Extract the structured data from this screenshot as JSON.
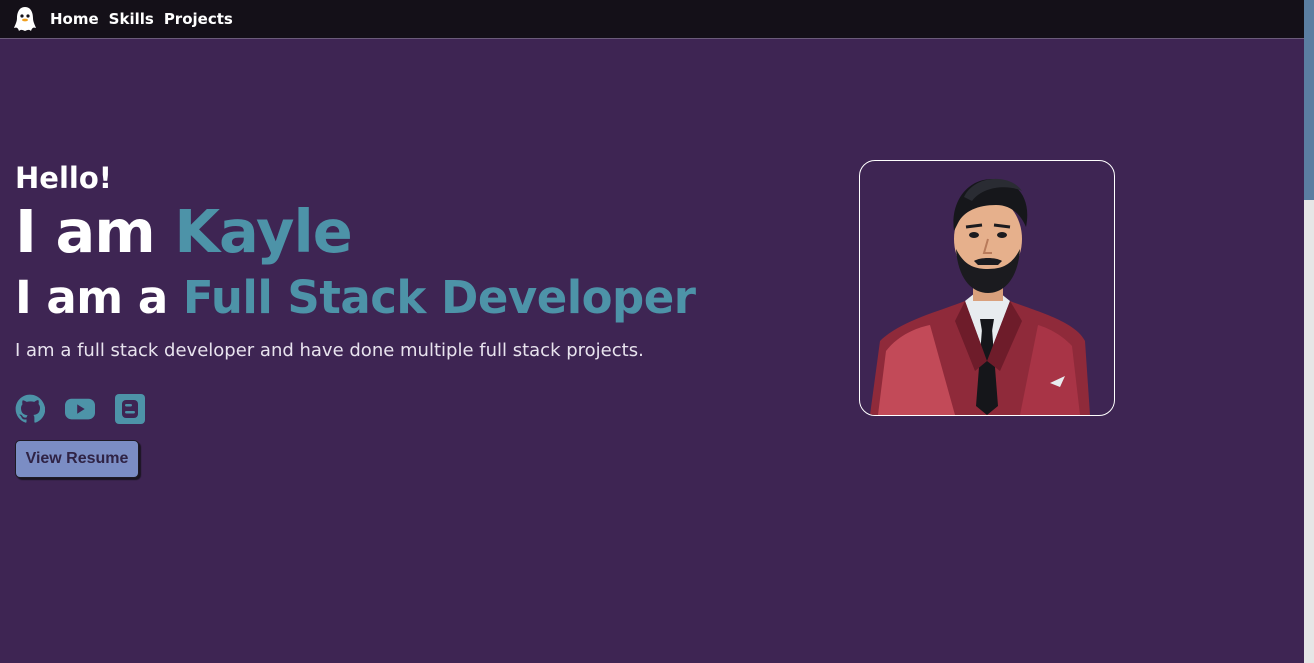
{
  "nav": {
    "logo_icon": "ghost-icon",
    "links": [
      "Home",
      "Skills",
      "Projects"
    ]
  },
  "hero": {
    "greeting": "Hello!",
    "name_prefix": "I am ",
    "name": "Kayle",
    "role_prefix": "I am a ",
    "role": "Full Stack Developer",
    "description": "I am a full stack developer and have done multiple full stack projects.",
    "socials": [
      "github-icon",
      "youtube-icon",
      "blogger-icon"
    ],
    "resume_button": "View Resume"
  },
  "colors": {
    "background": "#3e2553",
    "navbar": "#141018",
    "accent": "#4d93a8",
    "button": "#7b8dc4"
  }
}
